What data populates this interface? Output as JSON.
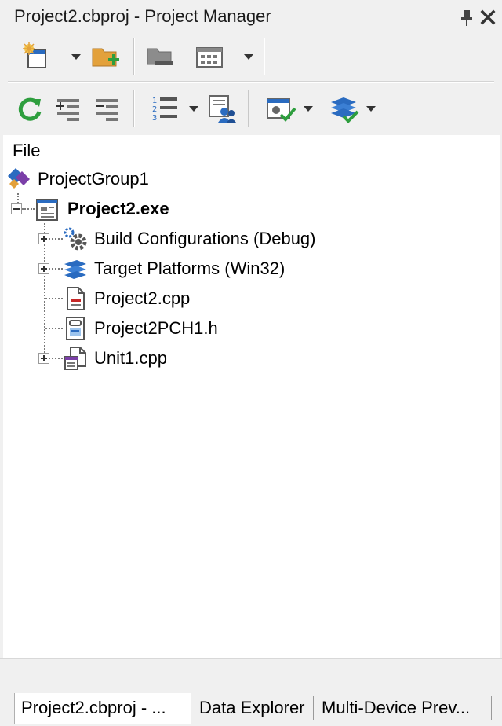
{
  "window": {
    "title": "Project2.cbproj - Project Manager",
    "pin_icon": "pin-icon",
    "close_icon": "close-icon"
  },
  "toolbar1": {
    "icons": [
      "new-project-icon",
      "chevron-down-icon",
      "add-folder-icon",
      "remove-folder-icon",
      "view-grid-icon",
      "chevron-down-icon"
    ]
  },
  "toolbar2": {
    "icons": [
      "sync-icon",
      "expand-all-icon",
      "collapse-all-icon",
      "sort-list-icon",
      "chevron-down-icon",
      "manage-users-icon",
      "build-check-icon",
      "chevron-down-icon",
      "layers-check-icon",
      "chevron-down-icon"
    ]
  },
  "tree": {
    "header": "File",
    "items": [
      {
        "label": "ProjectGroup1",
        "icon": "project-group-icon",
        "bold": false
      },
      {
        "label": "Project2.exe",
        "icon": "project-exe-icon",
        "bold": true
      },
      {
        "label": "Build Configurations (Debug)",
        "icon": "gear-icon",
        "bold": false
      },
      {
        "label": "Target Platforms (Win32)",
        "icon": "layers-icon",
        "bold": false
      },
      {
        "label": "Project2.cpp",
        "icon": "cpp-file-icon",
        "bold": false
      },
      {
        "label": "Project2PCH1.h",
        "icon": "header-file-icon",
        "bold": false
      },
      {
        "label": "Unit1.cpp",
        "icon": "unit-file-icon",
        "bold": false
      }
    ]
  },
  "tabs": [
    {
      "label": "Project2.cbproj - ...",
      "active": true
    },
    {
      "label": "Data Explorer",
      "active": false
    },
    {
      "label": "Multi-Device Prev...",
      "active": false
    }
  ],
  "colors": {
    "accent_green": "#2e9e3e",
    "accent_blue": "#2a6bc0",
    "accent_purple": "#7b3fa8",
    "accent_orange": "#e3a13b"
  }
}
